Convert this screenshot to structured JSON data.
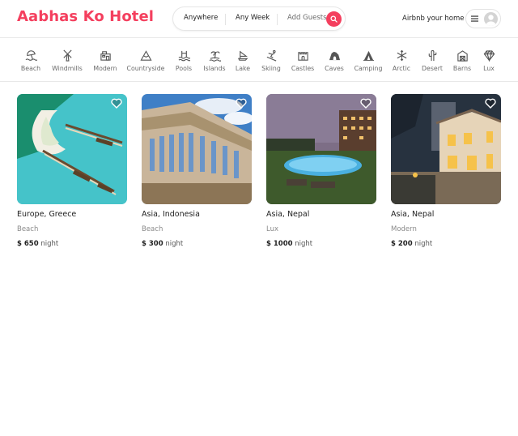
{
  "header": {
    "logo": "Aabhas Ko Hotel",
    "search": {
      "where": "Anywhere",
      "when": "Any Week",
      "who": "Add Guests"
    },
    "host_link": "Airbnb your home"
  },
  "categories": [
    {
      "label": "Beach",
      "icon": "beach-icon"
    },
    {
      "label": "Windmills",
      "icon": "windmill-icon"
    },
    {
      "label": "Modern",
      "icon": "modern-icon"
    },
    {
      "label": "Countryside",
      "icon": "mountain-icon"
    },
    {
      "label": "Pools",
      "icon": "pool-icon"
    },
    {
      "label": "Islands",
      "icon": "island-icon"
    },
    {
      "label": "Lake",
      "icon": "boat-icon"
    },
    {
      "label": "Skiing",
      "icon": "skiing-icon"
    },
    {
      "label": "Castles",
      "icon": "castle-icon"
    },
    {
      "label": "Caves",
      "icon": "cave-icon"
    },
    {
      "label": "Camping",
      "icon": "tent-icon"
    },
    {
      "label": "Arctic",
      "icon": "snowflake-icon"
    },
    {
      "label": "Desert",
      "icon": "cactus-icon"
    },
    {
      "label": "Barns",
      "icon": "barn-icon"
    },
    {
      "label": "Lux",
      "icon": "diamond-icon"
    }
  ],
  "listings": [
    {
      "location": "Europe, Greece",
      "category": "Beach",
      "price": "$ 650",
      "unit": "night"
    },
    {
      "location": "Asia, Indonesia",
      "category": "Beach",
      "price": "$ 300",
      "unit": "night"
    },
    {
      "location": "Asia, Nepal",
      "category": "Lux",
      "price": "$ 1000",
      "unit": "night"
    },
    {
      "location": "Asia, Nepal",
      "category": "Modern",
      "price": "$ 200",
      "unit": "night"
    }
  ],
  "colors": {
    "brand": "#f43f5e",
    "muted": "#6b6b6b"
  }
}
